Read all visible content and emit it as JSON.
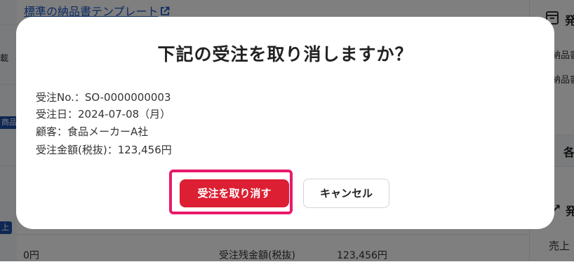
{
  "background": {
    "template_link": "標準の納品書テンプレート",
    "left_col": {
      "text_1": "載",
      "badge_1": "商品",
      "badge_2": "上"
    },
    "bottom_row": {
      "left_value": "0円",
      "label": "受注残金額(税抜)",
      "value": "123,456円"
    },
    "right_panel": {
      "heading": "発",
      "item_1": "納品書",
      "item_2": "納品書",
      "section_label": "各",
      "arrow_label": "↗",
      "arrow_heading": "発",
      "bottom_text": "売上"
    }
  },
  "dialog": {
    "title": "下記の受注を取り消しますか？",
    "details": [
      "受注No.：SO-0000000003",
      "受注日：2024-07-08（月）",
      "顧客：食品メーカーA社",
      "受注金額(税抜)：123,456円"
    ],
    "confirm_button": "受注を取り消す",
    "cancel_button": "キャンセル"
  },
  "colors": {
    "confirm_button": "#dc1f32",
    "highlight_frame": "#e8196b",
    "badge": "#1f4fa8",
    "link": "#1a56c4"
  }
}
